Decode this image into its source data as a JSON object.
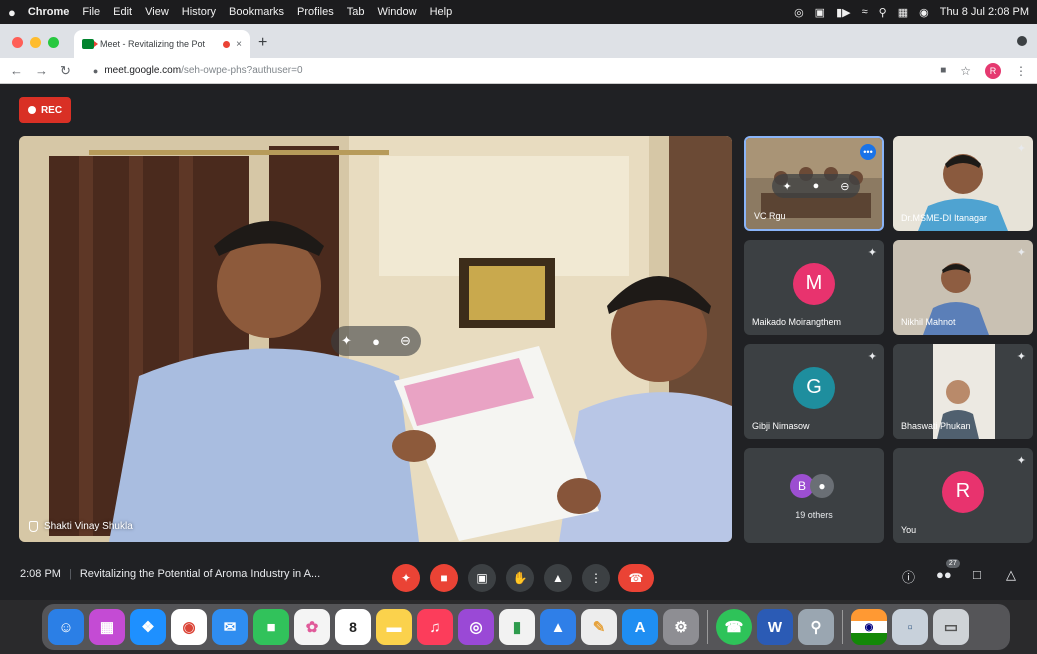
{
  "menubar": {
    "apple": "",
    "items": [
      "Chrome",
      "File",
      "Edit",
      "View",
      "History",
      "Bookmarks",
      "Profiles",
      "Tab",
      "Window",
      "Help"
    ],
    "clock": "Thu 8 Jul  2:08 PM"
  },
  "browser": {
    "tab_title": "Meet - Revitalizing the Pot",
    "tab_close": "×",
    "new_tab": "+",
    "url_host": "meet.google.com",
    "url_path": "/seh-owpe-phs?authuser=0",
    "profile_initial": "R"
  },
  "meet": {
    "rec_label": "REC",
    "main_speaker": "Shakti Vinay Shukla",
    "participants": [
      {
        "name": "VC Rgu",
        "type": "video"
      },
      {
        "name": "Dr.MSME-DI Itanagar",
        "type": "video"
      },
      {
        "name": "Maikado Moirangthem",
        "type": "avatar",
        "initial": "M",
        "color": "#e8336e"
      },
      {
        "name": "Nikhil Mahnot",
        "type": "video"
      },
      {
        "name": "Gibji Nimasow",
        "type": "avatar",
        "initial": "G",
        "color": "#1e8e9e"
      },
      {
        "name": "Bhaswati Phukan",
        "type": "video"
      },
      {
        "name": "You",
        "type": "avatar",
        "initial": "R",
        "color": "#e8336e"
      }
    ],
    "others": {
      "initial": "B",
      "count_label": "19 others"
    },
    "time": "2:08 PM",
    "meeting_title": "Revitalizing the Potential of Aroma Industry in A...",
    "people_count": "27"
  },
  "colors": {
    "rec": "#d93025",
    "hangup": "#ea4335",
    "tile_bg": "#3c4043",
    "stage_bg": "#202124"
  },
  "dock": {
    "calendar_day": "8",
    "word_label": "W"
  }
}
